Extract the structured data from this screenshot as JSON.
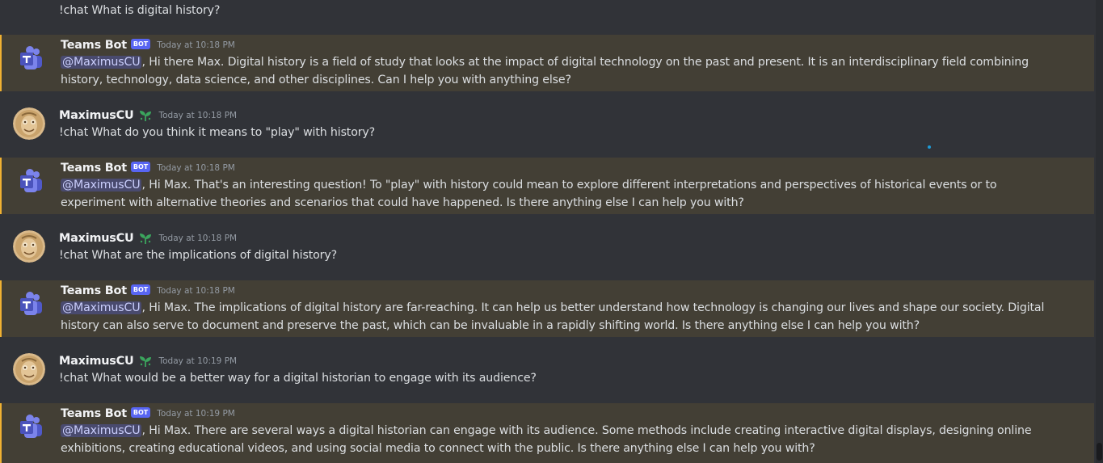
{
  "top_partial_message": "!chat What is digital history?",
  "colors": {
    "background": "#313338",
    "mention_highlight": "#433f35",
    "mention_bar": "#f0b132",
    "bot_tag": "#5865f2",
    "mention_text": "#c9cdfb"
  },
  "messages": [
    {
      "author": "Teams Bot",
      "bot_tag": "BOT",
      "timestamp": "Today at 10:18 PM",
      "mention": "@MaximusCU",
      "text": ", Hi there Max. Digital history is a field of study that looks at the impact of digital technology on the past and present. It is an interdisciplinary field combining history, technology, data science, and other disciplines. Can I help you with anything else?",
      "avatar_icon": "teams-icon"
    },
    {
      "author": "MaximusCU",
      "timestamp": "Today at 10:18 PM",
      "text": "!chat What do you think it means to \"play\" with history?",
      "avatar_icon": "user-avatar",
      "badge_icon": "sprout-icon"
    },
    {
      "author": "Teams Bot",
      "bot_tag": "BOT",
      "timestamp": "Today at 10:18 PM",
      "mention": "@MaximusCU",
      "text": ", Hi Max. That's an interesting question! To \"play\" with history could mean to explore different interpretations and perspectives of historical events or to experiment with alternative theories and scenarios that could have happened. Is there anything else I can help you with?",
      "avatar_icon": "teams-icon"
    },
    {
      "author": "MaximusCU",
      "timestamp": "Today at 10:18 PM",
      "text": "!chat What are the implications of digital history?",
      "avatar_icon": "user-avatar",
      "badge_icon": "sprout-icon"
    },
    {
      "author": "Teams Bot",
      "bot_tag": "BOT",
      "timestamp": "Today at 10:18 PM",
      "mention": "@MaximusCU",
      "text": ", Hi Max. The implications of digital history are far-reaching. It can help us better understand how technology is changing our lives and shape our society. Digital history can also serve to document and preserve the past, which can be invaluable in a rapidly shifting world. Is there anything else I can help you with?",
      "avatar_icon": "teams-icon"
    },
    {
      "author": "MaximusCU",
      "timestamp": "Today at 10:19 PM",
      "text": "!chat What would be a better way for a digital historian to engage with its audience?",
      "avatar_icon": "user-avatar",
      "badge_icon": "sprout-icon"
    },
    {
      "author": "Teams Bot",
      "bot_tag": "BOT",
      "timestamp": "Today at 10:19 PM",
      "mention": "@MaximusCU",
      "text": ", Hi Max. There are several ways a digital historian can engage with its audience. Some methods include creating interactive digital displays, designing online exhibitions, creating educational videos, and using social media to connect with the public. Is there anything else I can help you with?",
      "avatar_icon": "teams-icon"
    }
  ]
}
